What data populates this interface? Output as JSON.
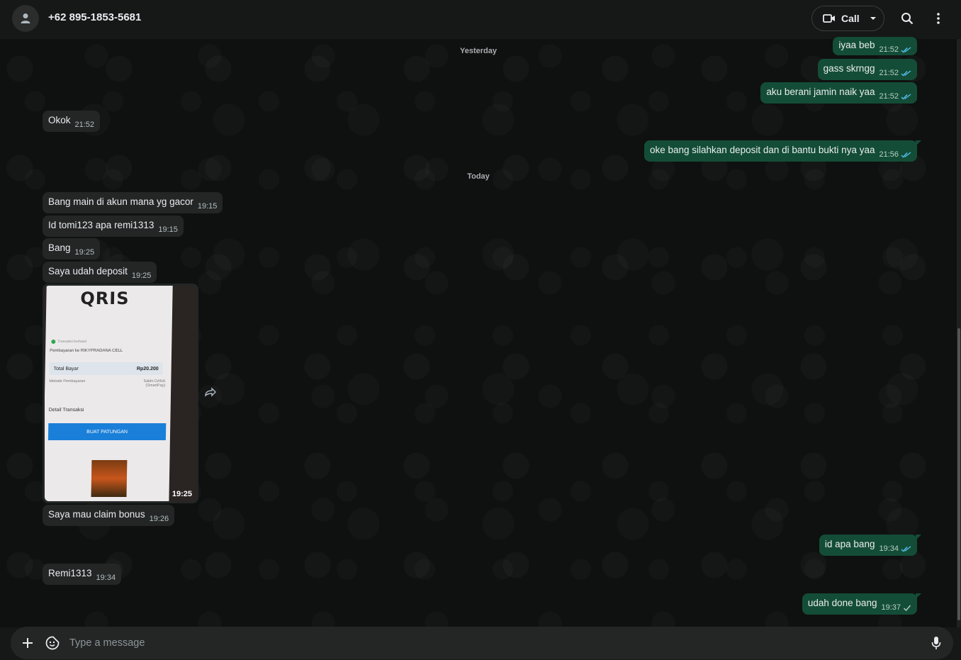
{
  "header": {
    "contact_name": "+62 895-1853-5681",
    "call_label": "Call",
    "icons": [
      "avatar-icon",
      "video-camera-icon",
      "chevron-down-icon",
      "search-icon",
      "more-vertical-icon"
    ]
  },
  "dates": {
    "yesterday": "Yesterday",
    "today": "Today"
  },
  "messages": {
    "m1": {
      "dir": "out",
      "text": "iyaa beb",
      "time": "21:52",
      "status": "read"
    },
    "m2": {
      "dir": "out",
      "text": "gass skrngg",
      "time": "21:52",
      "status": "read"
    },
    "m3": {
      "dir": "out",
      "text": "aku berani jamin naik yaa",
      "time": "21:52",
      "status": "read"
    },
    "m4": {
      "dir": "in",
      "text": "Okok",
      "time": "21:52"
    },
    "m5": {
      "dir": "out",
      "text": "oke bang silahkan deposit dan di bantu bukti nya yaa",
      "time": "21:56",
      "status": "read"
    },
    "m6": {
      "dir": "in",
      "text": "Bang main di akun mana yg gacor",
      "time": "19:15"
    },
    "m7": {
      "dir": "in",
      "text": "Id tomi123 apa remi1313",
      "time": "19:15"
    },
    "m8": {
      "dir": "in",
      "text": "Bang",
      "time": "19:25"
    },
    "m9": {
      "dir": "in",
      "text": "Saya udah deposit",
      "time": "19:25"
    },
    "m10": {
      "dir": "in",
      "type": "image",
      "time": "19:25"
    },
    "m11": {
      "dir": "in",
      "text": "Saya mau claim bonus",
      "time": "19:26"
    },
    "m12": {
      "dir": "out",
      "text": "id apa bang",
      "time": "19:34",
      "status": "read"
    },
    "m13": {
      "dir": "in",
      "text": "Remi1313",
      "time": "19:34"
    },
    "m14": {
      "dir": "out",
      "text": "udah done bang",
      "time": "19:37",
      "status": "sent"
    }
  },
  "receipt": {
    "logo": "QRIS",
    "status": "Transaksi berhasil",
    "merchant": "Pembayaran ke RIKYPRADANA CELL",
    "total_label": "Total Bayar",
    "total_value": "Rp20.200",
    "method_label": "Metode Pembayaran",
    "method_value": "Saldo DANA (SmartPay)",
    "detail_label": "Detail Transaksi",
    "button_label": "BUAT PATUNGAN"
  },
  "composer": {
    "placeholder": "Type a message",
    "icons": [
      "plus-icon",
      "sticker-icon",
      "microphone-icon"
    ]
  },
  "colors": {
    "incoming_bubble": "#242626",
    "outgoing_bubble": "#144d37",
    "read_tick": "#53bdeb",
    "background": "#161717"
  }
}
